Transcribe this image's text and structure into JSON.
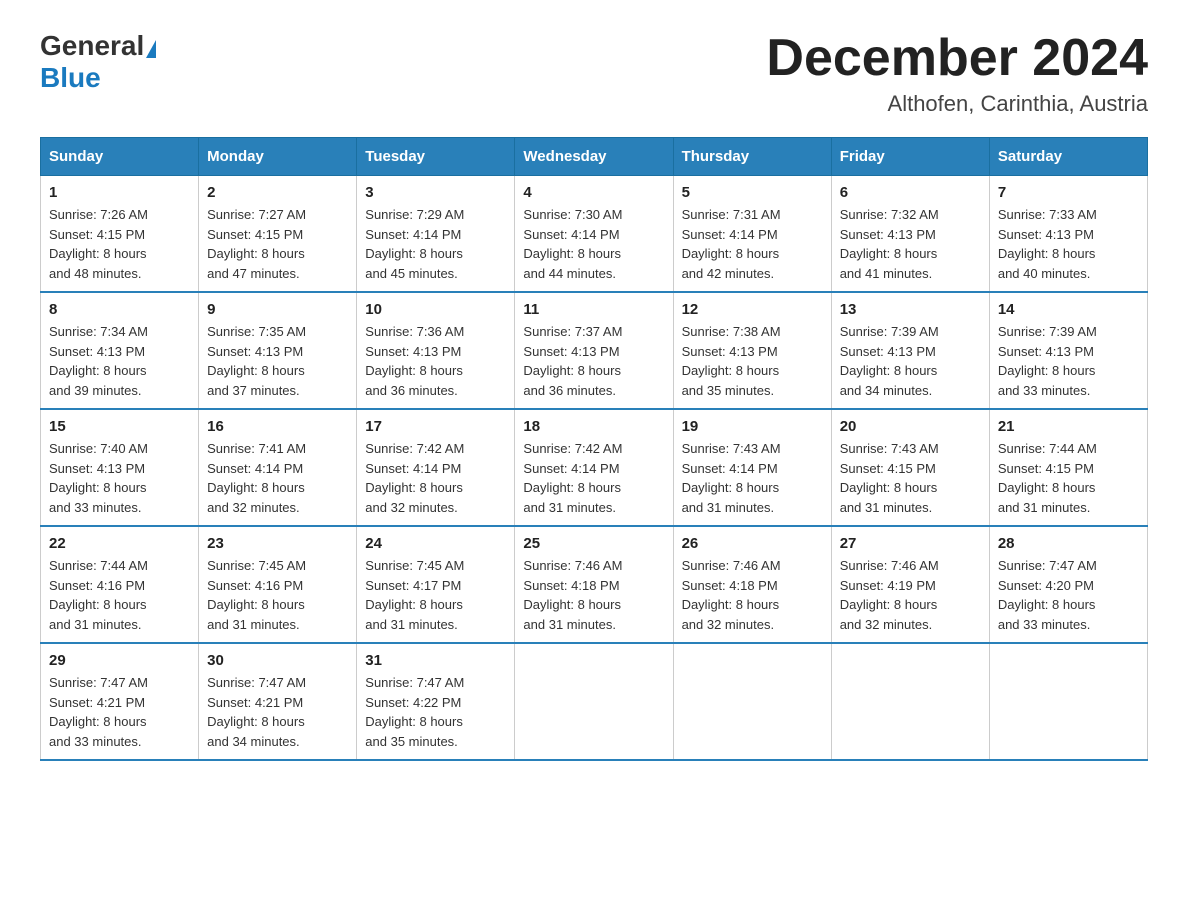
{
  "header": {
    "logo_general": "General",
    "logo_blue": "Blue",
    "month_title": "December 2024",
    "location": "Althofen, Carinthia, Austria"
  },
  "weekdays": [
    "Sunday",
    "Monday",
    "Tuesday",
    "Wednesday",
    "Thursday",
    "Friday",
    "Saturday"
  ],
  "weeks": [
    [
      {
        "day": "1",
        "sunrise": "7:26 AM",
        "sunset": "4:15 PM",
        "daylight": "8 hours and 48 minutes."
      },
      {
        "day": "2",
        "sunrise": "7:27 AM",
        "sunset": "4:15 PM",
        "daylight": "8 hours and 47 minutes."
      },
      {
        "day": "3",
        "sunrise": "7:29 AM",
        "sunset": "4:14 PM",
        "daylight": "8 hours and 45 minutes."
      },
      {
        "day": "4",
        "sunrise": "7:30 AM",
        "sunset": "4:14 PM",
        "daylight": "8 hours and 44 minutes."
      },
      {
        "day": "5",
        "sunrise": "7:31 AM",
        "sunset": "4:14 PM",
        "daylight": "8 hours and 42 minutes."
      },
      {
        "day": "6",
        "sunrise": "7:32 AM",
        "sunset": "4:13 PM",
        "daylight": "8 hours and 41 minutes."
      },
      {
        "day": "7",
        "sunrise": "7:33 AM",
        "sunset": "4:13 PM",
        "daylight": "8 hours and 40 minutes."
      }
    ],
    [
      {
        "day": "8",
        "sunrise": "7:34 AM",
        "sunset": "4:13 PM",
        "daylight": "8 hours and 39 minutes."
      },
      {
        "day": "9",
        "sunrise": "7:35 AM",
        "sunset": "4:13 PM",
        "daylight": "8 hours and 37 minutes."
      },
      {
        "day": "10",
        "sunrise": "7:36 AM",
        "sunset": "4:13 PM",
        "daylight": "8 hours and 36 minutes."
      },
      {
        "day": "11",
        "sunrise": "7:37 AM",
        "sunset": "4:13 PM",
        "daylight": "8 hours and 36 minutes."
      },
      {
        "day": "12",
        "sunrise": "7:38 AM",
        "sunset": "4:13 PM",
        "daylight": "8 hours and 35 minutes."
      },
      {
        "day": "13",
        "sunrise": "7:39 AM",
        "sunset": "4:13 PM",
        "daylight": "8 hours and 34 minutes."
      },
      {
        "day": "14",
        "sunrise": "7:39 AM",
        "sunset": "4:13 PM",
        "daylight": "8 hours and 33 minutes."
      }
    ],
    [
      {
        "day": "15",
        "sunrise": "7:40 AM",
        "sunset": "4:13 PM",
        "daylight": "8 hours and 33 minutes."
      },
      {
        "day": "16",
        "sunrise": "7:41 AM",
        "sunset": "4:14 PM",
        "daylight": "8 hours and 32 minutes."
      },
      {
        "day": "17",
        "sunrise": "7:42 AM",
        "sunset": "4:14 PM",
        "daylight": "8 hours and 32 minutes."
      },
      {
        "day": "18",
        "sunrise": "7:42 AM",
        "sunset": "4:14 PM",
        "daylight": "8 hours and 31 minutes."
      },
      {
        "day": "19",
        "sunrise": "7:43 AM",
        "sunset": "4:14 PM",
        "daylight": "8 hours and 31 minutes."
      },
      {
        "day": "20",
        "sunrise": "7:43 AM",
        "sunset": "4:15 PM",
        "daylight": "8 hours and 31 minutes."
      },
      {
        "day": "21",
        "sunrise": "7:44 AM",
        "sunset": "4:15 PM",
        "daylight": "8 hours and 31 minutes."
      }
    ],
    [
      {
        "day": "22",
        "sunrise": "7:44 AM",
        "sunset": "4:16 PM",
        "daylight": "8 hours and 31 minutes."
      },
      {
        "day": "23",
        "sunrise": "7:45 AM",
        "sunset": "4:16 PM",
        "daylight": "8 hours and 31 minutes."
      },
      {
        "day": "24",
        "sunrise": "7:45 AM",
        "sunset": "4:17 PM",
        "daylight": "8 hours and 31 minutes."
      },
      {
        "day": "25",
        "sunrise": "7:46 AM",
        "sunset": "4:18 PM",
        "daylight": "8 hours and 31 minutes."
      },
      {
        "day": "26",
        "sunrise": "7:46 AM",
        "sunset": "4:18 PM",
        "daylight": "8 hours and 32 minutes."
      },
      {
        "day": "27",
        "sunrise": "7:46 AM",
        "sunset": "4:19 PM",
        "daylight": "8 hours and 32 minutes."
      },
      {
        "day": "28",
        "sunrise": "7:47 AM",
        "sunset": "4:20 PM",
        "daylight": "8 hours and 33 minutes."
      }
    ],
    [
      {
        "day": "29",
        "sunrise": "7:47 AM",
        "sunset": "4:21 PM",
        "daylight": "8 hours and 33 minutes."
      },
      {
        "day": "30",
        "sunrise": "7:47 AM",
        "sunset": "4:21 PM",
        "daylight": "8 hours and 34 minutes."
      },
      {
        "day": "31",
        "sunrise": "7:47 AM",
        "sunset": "4:22 PM",
        "daylight": "8 hours and 35 minutes."
      },
      null,
      null,
      null,
      null
    ]
  ],
  "labels": {
    "sunrise": "Sunrise:",
    "sunset": "Sunset:",
    "daylight": "Daylight:"
  }
}
